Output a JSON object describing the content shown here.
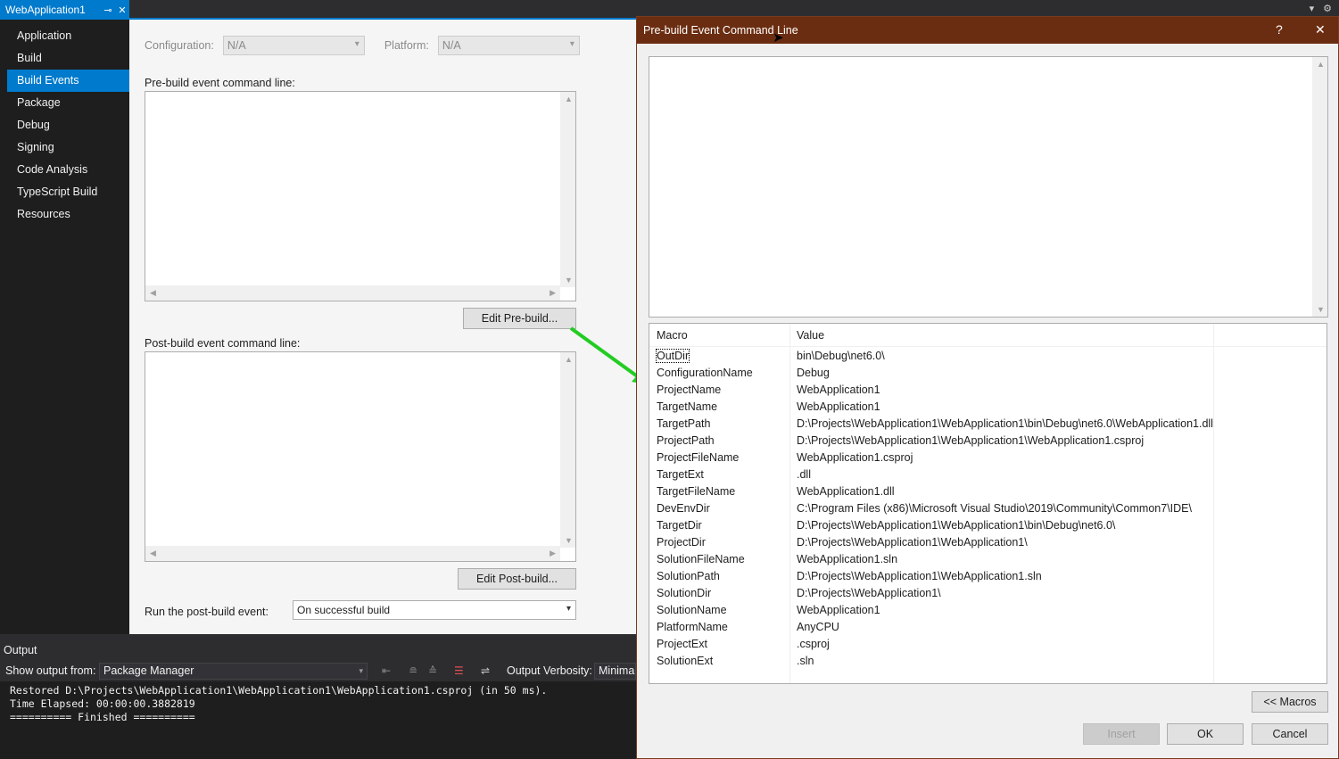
{
  "tab": {
    "title": "WebApplication1",
    "pin": "⊸",
    "close": "✕"
  },
  "topright": {
    "dropdown": "▾",
    "gear": "⚙"
  },
  "nav": {
    "items": [
      {
        "label": "Application"
      },
      {
        "label": "Build"
      },
      {
        "label": "Build Events"
      },
      {
        "label": "Package"
      },
      {
        "label": "Debug"
      },
      {
        "label": "Signing"
      },
      {
        "label": "Code Analysis"
      },
      {
        "label": "TypeScript Build"
      },
      {
        "label": "Resources"
      }
    ],
    "active": "Build Events"
  },
  "config": {
    "configuration_label": "Configuration:",
    "configuration_value": "N/A",
    "platform_label": "Platform:",
    "platform_value": "N/A"
  },
  "events": {
    "prebuild_label": "Pre-build event command line:",
    "edit_prebuild": "Edit Pre-build...",
    "postbuild_label": "Post-build event command line:",
    "edit_postbuild": "Edit Post-build...",
    "run_label": "Run the post-build event:",
    "run_value": "On successful build"
  },
  "output": {
    "title": "Output",
    "show_from_label": "Show output from:",
    "show_from_value": "Package Manager",
    "verbosity_label": "Output Verbosity:",
    "verbosity_value": "Minima",
    "lines": [
      "Restored D:\\Projects\\WebApplication1\\WebApplication1\\WebApplication1.csproj (in 50 ms).",
      "Time Elapsed: 00:00:00.3882819",
      "========== Finished =========="
    ]
  },
  "dialog": {
    "title": "Pre-build Event Command Line",
    "help": "?",
    "close": "✕",
    "col_macro": "Macro",
    "col_value": "Value",
    "macros": [
      {
        "name": "OutDir",
        "value": "bin\\Debug\\net6.0\\"
      },
      {
        "name": "ConfigurationName",
        "value": "Debug"
      },
      {
        "name": "ProjectName",
        "value": "WebApplication1"
      },
      {
        "name": "TargetName",
        "value": "WebApplication1"
      },
      {
        "name": "TargetPath",
        "value": "D:\\Projects\\WebApplication1\\WebApplication1\\bin\\Debug\\net6.0\\WebApplication1.dll"
      },
      {
        "name": "ProjectPath",
        "value": "D:\\Projects\\WebApplication1\\WebApplication1\\WebApplication1.csproj"
      },
      {
        "name": "ProjectFileName",
        "value": "WebApplication1.csproj"
      },
      {
        "name": "TargetExt",
        "value": ".dll"
      },
      {
        "name": "TargetFileName",
        "value": "WebApplication1.dll"
      },
      {
        "name": "DevEnvDir",
        "value": "C:\\Program Files (x86)\\Microsoft Visual Studio\\2019\\Community\\Common7\\IDE\\"
      },
      {
        "name": "TargetDir",
        "value": "D:\\Projects\\WebApplication1\\WebApplication1\\bin\\Debug\\net6.0\\"
      },
      {
        "name": "ProjectDir",
        "value": "D:\\Projects\\WebApplication1\\WebApplication1\\"
      },
      {
        "name": "SolutionFileName",
        "value": "WebApplication1.sln"
      },
      {
        "name": "SolutionPath",
        "value": "D:\\Projects\\WebApplication1\\WebApplication1.sln"
      },
      {
        "name": "SolutionDir",
        "value": "D:\\Projects\\WebApplication1\\"
      },
      {
        "name": "SolutionName",
        "value": "WebApplication1"
      },
      {
        "name": "PlatformName",
        "value": "AnyCPU"
      },
      {
        "name": "ProjectExt",
        "value": ".csproj"
      },
      {
        "name": "SolutionExt",
        "value": ".sln"
      }
    ],
    "macros_button": "<< Macros",
    "insert_button": "Insert",
    "ok_button": "OK",
    "cancel_button": "Cancel"
  },
  "colors": {
    "accent": "#007acc",
    "dialog_title": "#6b2d11",
    "annotation_arrow": "#22cc22"
  }
}
